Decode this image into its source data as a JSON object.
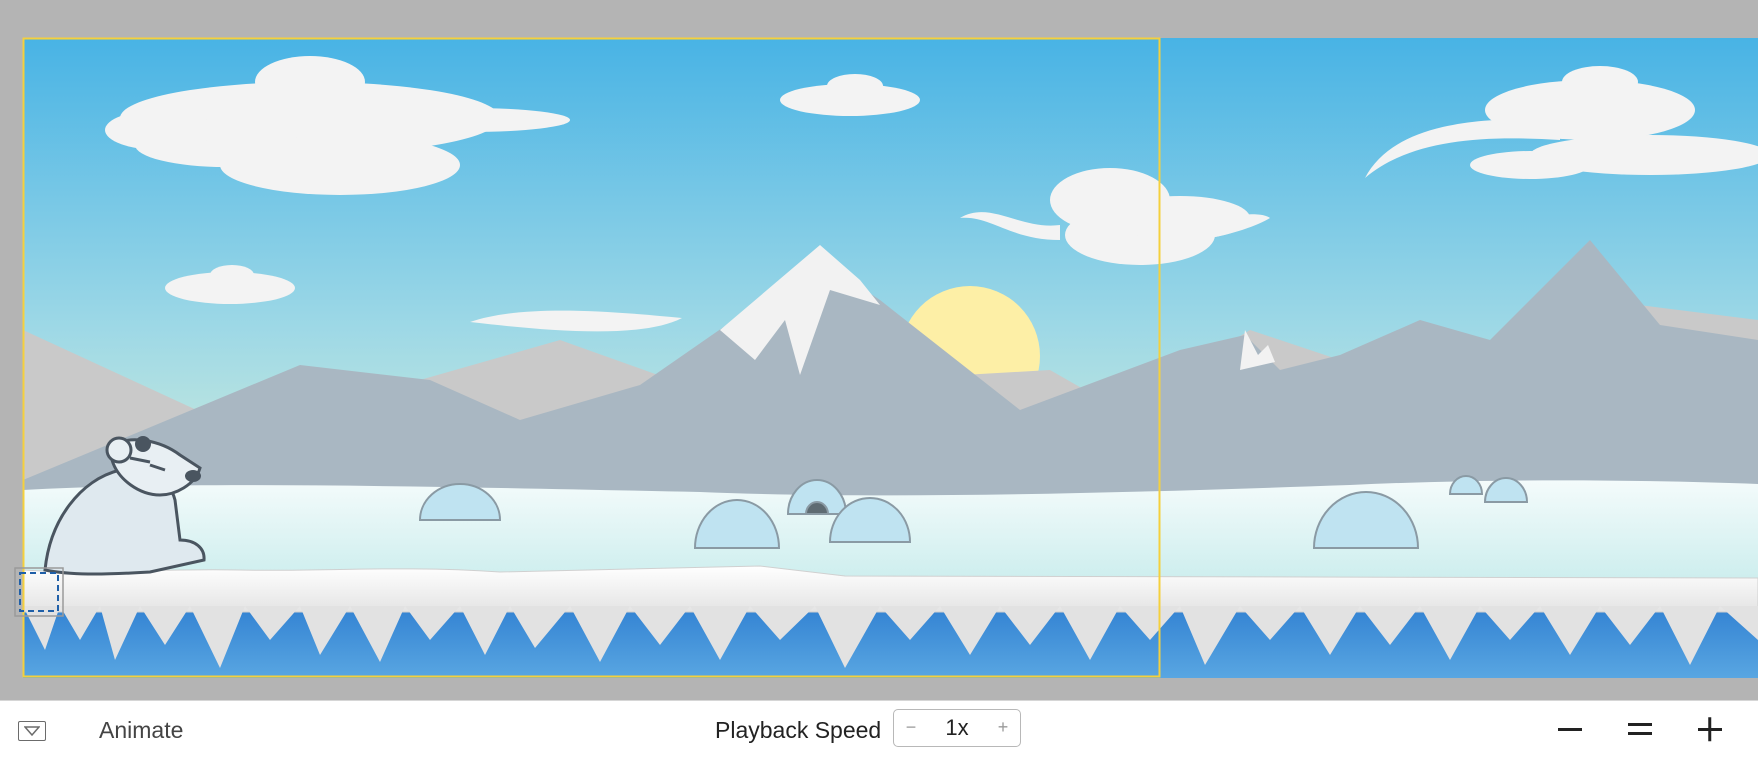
{
  "bottom_bar": {
    "toggle_icon": "triangle-down-icon",
    "animate_label": "Animate",
    "playback_speed_label": "Playback Speed",
    "speed": {
      "decrement": "−",
      "value": "1x",
      "increment": "+"
    },
    "zoom": {
      "out_icon": "minus-icon",
      "fit_icon": "equals-icon",
      "in_icon": "plus-icon"
    }
  },
  "colors": {
    "sky_top": "#4bb4e6",
    "sky_bottom": "#d9f3d7",
    "sun": "#fdefa6",
    "frame_border": "#f5d03d",
    "water": "#4a97d9",
    "selection": "#1f5fa8"
  }
}
